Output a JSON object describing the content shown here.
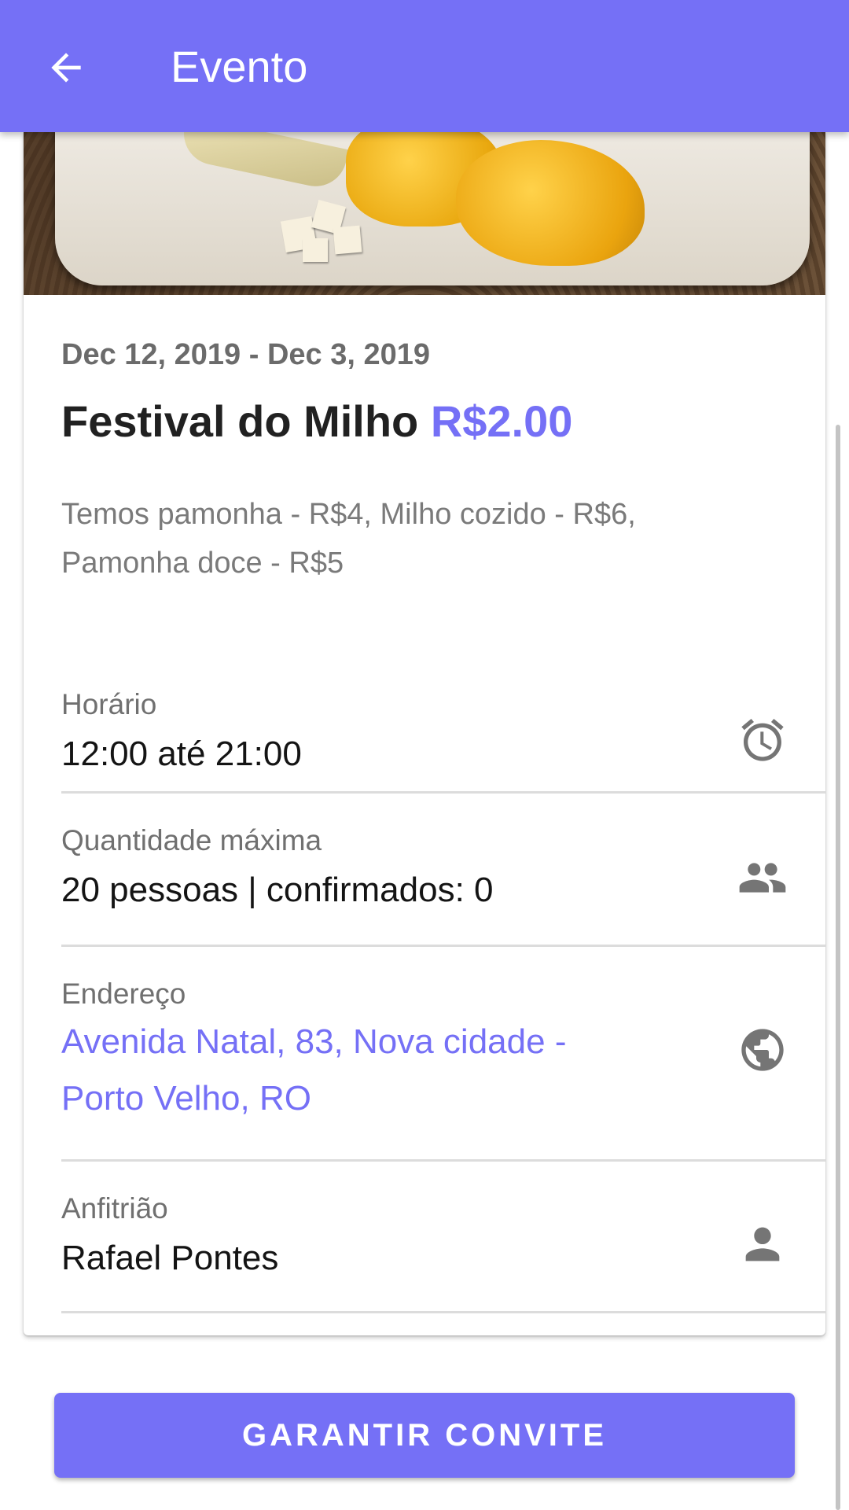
{
  "appbar": {
    "title": "Evento",
    "back_icon": "arrow-back-icon"
  },
  "event": {
    "date_range": "Dec 12, 2019 - Dec 3, 2019",
    "name": "Festival do Milho",
    "price": "R$2.00",
    "description": "Temos pamonha - R$4, Milho cozido - R$6, Pamonha doce - R$5"
  },
  "details": {
    "schedule": {
      "label": "Horário",
      "value": "12:00 até 21:00",
      "icon": "alarm-clock-icon"
    },
    "capacity": {
      "label": "Quantidade máxima",
      "value": "20 pessoas | confirmados: 0",
      "icon": "people-icon"
    },
    "address": {
      "label": "Endereço",
      "value": "Avenida Natal, 83, Nova cidade - Porto Velho, RO",
      "icon": "globe-icon"
    },
    "host": {
      "label": "Anfitrião",
      "value": "Rafael Pontes",
      "icon": "person-icon"
    }
  },
  "cta": {
    "label": "GARANTIR CONVITE"
  },
  "colors": {
    "accent": "#7570F6",
    "icon": "#757575"
  }
}
